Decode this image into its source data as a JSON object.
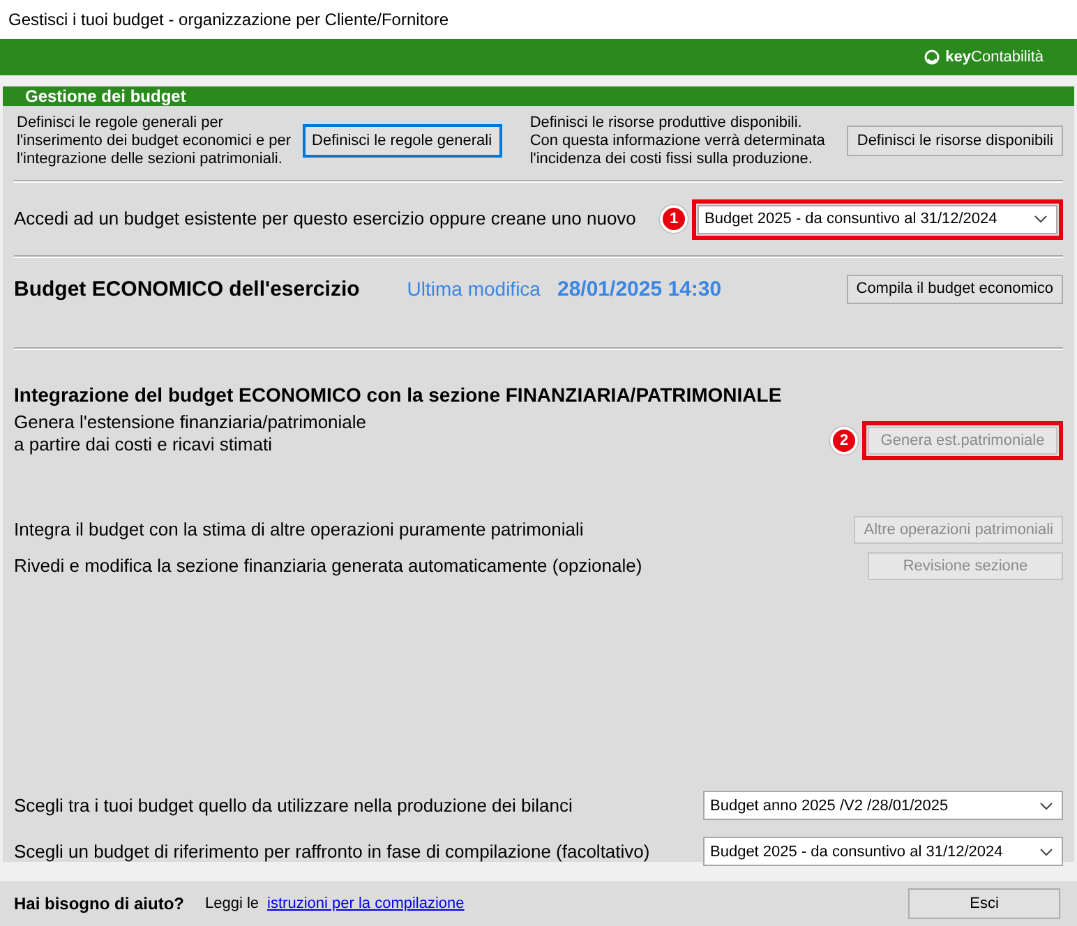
{
  "window": {
    "title": "Gestisci i tuoi budget - organizzazione per Cliente/Fornitore"
  },
  "brand": {
    "bold": "key",
    "rest": "Contabilità"
  },
  "panel": {
    "title": "Gestione dei budget"
  },
  "rules": {
    "text": "Definisci le regole generali per\nl'inserimento dei budget economici e per\nl'integrazione delle sezioni patrimoniali.",
    "button": {
      "label": "Definisci le regole generali",
      "focused": true,
      "disabled": false
    }
  },
  "resources": {
    "text": "Definisci le risorse produttive disponibili.\nCon questa informazione verrà determinata\nl'incidenza dei costi fissi sulla produzione.",
    "button": {
      "label": "Definisci le risorse disponibili",
      "focused": false,
      "disabled": false
    }
  },
  "access": {
    "label": "Accedi ad un budget esistente per questo esercizio oppure creane uno nuovo",
    "marker": "1",
    "value": "Budget 2025 - da consuntivo al 31/12/2024"
  },
  "economic": {
    "title": "Budget ECONOMICO dell'esercizio",
    "modified_label": "Ultima modifica",
    "modified_value": "28/01/2025 14:30",
    "button": {
      "label": "Compila il budget economico",
      "disabled": false
    }
  },
  "integration": {
    "title": "Integrazione del budget ECONOMICO con la sezione FINANZIARIA/PATRIMONIALE",
    "generate": {
      "text": "Genera l'estensione finanziaria/patrimoniale\na partire dai costi e ricavi stimati",
      "marker": "2",
      "button": {
        "label": "Genera est.patrimoniale",
        "disabled": true
      }
    },
    "actions": [
      {
        "text": "Integra il budget con la stima di altre operazioni puramente patrimoniali",
        "button": {
          "label": "Altre operazioni patrimoniali",
          "disabled": true
        }
      },
      {
        "text": "Rivedi e modifica la sezione finanziaria generata automaticamente (opzionale)",
        "button": {
          "label": "Revisione sezione",
          "disabled": true
        }
      }
    ]
  },
  "choices": [
    {
      "label": "Scegli tra i tuoi budget quello da utilizzare nella produzione dei bilanci",
      "value": "Budget anno 2025 /V2 /28/01/2025"
    },
    {
      "label": "Scegli un budget di riferimento per raffronto in fase di compilazione (facoltativo)",
      "value": "Budget 2025 - da consuntivo al 31/12/2024"
    }
  ],
  "footer": {
    "question": "Hai bisogno di aiuto?",
    "lead": "Leggi le",
    "link": "istruzioni per la compilazione",
    "button": "Esci"
  }
}
